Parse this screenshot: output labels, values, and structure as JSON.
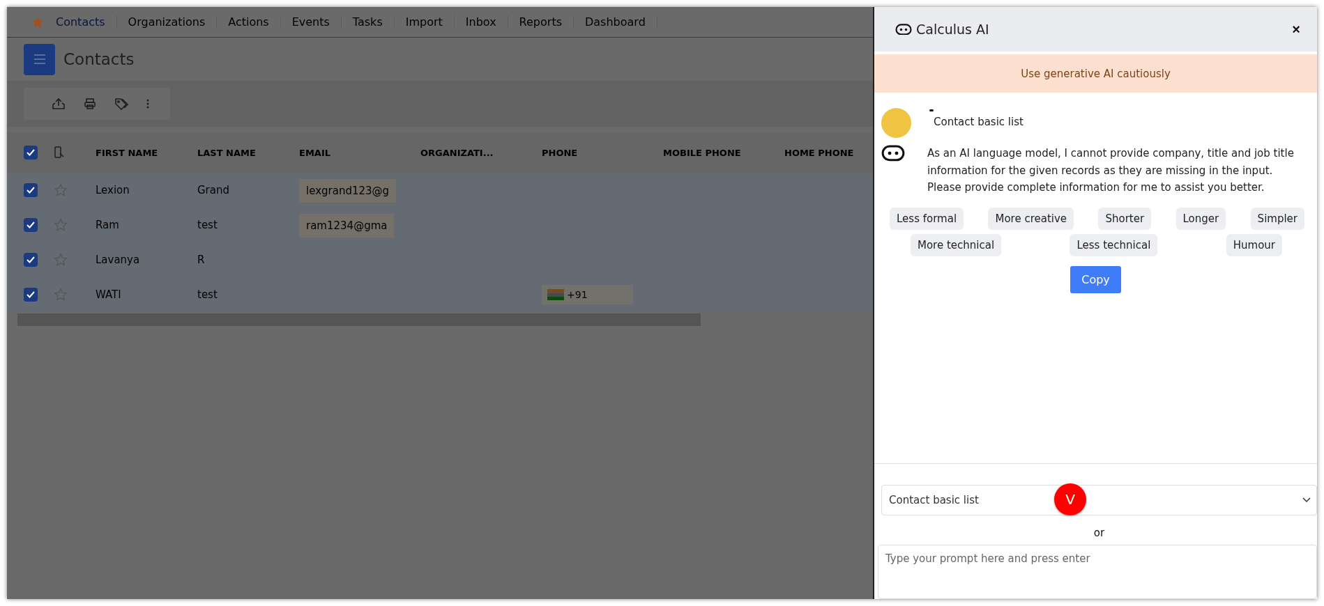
{
  "nav": {
    "items": [
      {
        "label": "Contacts",
        "selected": true
      },
      {
        "label": "Organizations",
        "selected": false
      },
      {
        "label": "Actions",
        "selected": false
      },
      {
        "label": "Events",
        "selected": false
      },
      {
        "label": "Tasks",
        "selected": false
      },
      {
        "label": "Import",
        "selected": false
      },
      {
        "label": "Inbox",
        "selected": false
      },
      {
        "label": "Reports",
        "selected": false
      },
      {
        "label": "Dashboard",
        "selected": false
      }
    ]
  },
  "page_title": "Contacts",
  "table": {
    "all_checked": true,
    "columns": [
      "FIRST NAME",
      "LAST NAME",
      "EMAIL",
      "ORGANIZATI...",
      "PHONE",
      "MOBILE PHONE",
      "HOME PHONE"
    ],
    "rows": [
      {
        "checked": true,
        "starred": false,
        "first_name": "Lexion",
        "last_name": "Grand",
        "email": "lexgrand123@g",
        "phone": ""
      },
      {
        "checked": true,
        "starred": false,
        "first_name": "Ram",
        "last_name": "test",
        "email": "ram1234@gma",
        "phone": ""
      },
      {
        "checked": true,
        "starred": false,
        "first_name": "Lavanya",
        "last_name": "R",
        "email": "",
        "phone": ""
      },
      {
        "checked": true,
        "starred": false,
        "first_name": "WATI",
        "last_name": "test",
        "email": "",
        "phone": "+91"
      }
    ]
  },
  "ai_panel": {
    "title": "Calculus AI",
    "close": "×",
    "warning": "Use generative AI cautiously",
    "user_message": "Contact basic list",
    "reply": "As an AI language model, I cannot provide company, title and job title information for the given records as they are missing in the input. Please provide complete information for me to assist you better.",
    "suggestion_rows": [
      [
        "Less formal",
        "More creative",
        "Shorter",
        "Longer",
        "Simpler"
      ],
      [
        "More technical",
        "Less technical",
        "Humour"
      ]
    ],
    "copy_button": "Copy",
    "list_select": {
      "value": "Contact basic list"
    },
    "badge": "V",
    "or": "or",
    "prompt": {
      "placeholder": "Type your prompt here and press enter"
    }
  }
}
